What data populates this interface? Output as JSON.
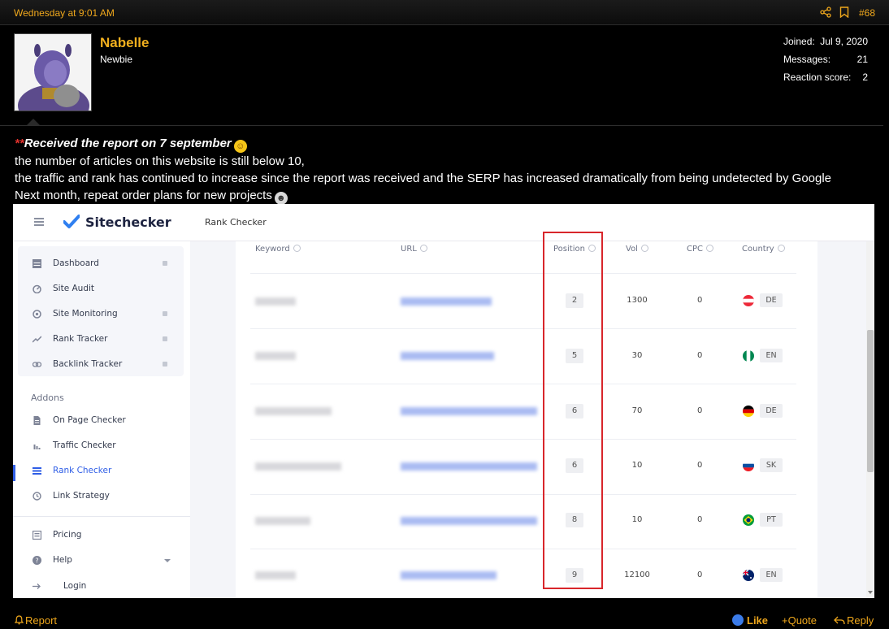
{
  "post": {
    "date": "Wednesday at 9:01 AM",
    "number": "#68"
  },
  "user": {
    "name": "Nabelle",
    "title": "Newbie",
    "stats": [
      {
        "label": "Joined:",
        "value": "Jul 9, 2020"
      },
      {
        "label": "Messages:",
        "value": "21"
      },
      {
        "label": "Reaction score:",
        "value": "2"
      }
    ]
  },
  "message": {
    "stars": "**",
    "heading": "Received the report on 7 september",
    "lines": [
      "the number of articles on this website is still below 10,",
      "the traffic and rank has continued to increase since the report was received and the SERP has increased dramatically from being undetected by Google",
      "Next month, repeat order plans for new projects"
    ]
  },
  "screenshot": {
    "logo": "Sitechecker",
    "breadcrumb": "Rank Checker",
    "nav_primary": [
      {
        "label": "Dashboard",
        "icon": "dashboard-icon"
      },
      {
        "label": "Site Audit",
        "icon": "gauge-icon"
      },
      {
        "label": "Site Monitoring",
        "icon": "monitoring-icon"
      },
      {
        "label": "Rank Tracker",
        "icon": "trend-icon"
      },
      {
        "label": "Backlink Tracker",
        "icon": "link-icon"
      }
    ],
    "addons_label": "Addons",
    "nav_addons": [
      {
        "label": "On Page Checker",
        "icon": "page-icon"
      },
      {
        "label": "Traffic Checker",
        "icon": "bars-icon"
      },
      {
        "label": "Rank Checker",
        "icon": "list-icon"
      },
      {
        "label": "Link Strategy",
        "icon": "history-icon"
      }
    ],
    "nav_bottom": [
      {
        "label": "Pricing",
        "icon": "pricing-icon"
      },
      {
        "label": "Help",
        "icon": "help-icon"
      },
      {
        "label": "Login",
        "icon": "arrow-right-icon"
      }
    ],
    "columns": [
      "Keyword",
      "URL",
      "Position",
      "Vol",
      "CPC",
      "Country"
    ],
    "rows": [
      {
        "position": "2",
        "vol": "1300",
        "cpc": "0",
        "country": "DE",
        "flag": "austria-flag"
      },
      {
        "position": "5",
        "vol": "30",
        "cpc": "0",
        "country": "EN",
        "flag": "nigeria-flag"
      },
      {
        "position": "6",
        "vol": "70",
        "cpc": "0",
        "country": "DE",
        "flag": "germany-flag"
      },
      {
        "position": "6",
        "vol": "10",
        "cpc": "0",
        "country": "SK",
        "flag": "slovakia-flag"
      },
      {
        "position": "8",
        "vol": "10",
        "cpc": "0",
        "country": "PT",
        "flag": "brazil-flag"
      },
      {
        "position": "9",
        "vol": "12100",
        "cpc": "0",
        "country": "EN",
        "flag": "australia-flag"
      }
    ]
  },
  "actions": {
    "report": "Report",
    "like": "Like",
    "quote": "+Quote",
    "reply": "Reply"
  },
  "colors": {
    "accent": "#f0a81c",
    "highlight": "#d8262b",
    "link_blue": "#2f5ee6"
  }
}
